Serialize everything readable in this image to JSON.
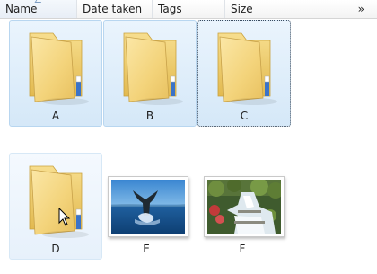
{
  "columns": {
    "name": "Name",
    "date_taken": "Date taken",
    "tags": "Tags",
    "size": "Size",
    "more": "»"
  },
  "items": [
    {
      "label": "A",
      "type": "folder",
      "state": "selected"
    },
    {
      "label": "B",
      "type": "folder",
      "state": "selected"
    },
    {
      "label": "C",
      "type": "folder",
      "state": "selected-focused"
    },
    {
      "label": "D",
      "type": "folder",
      "state": "hover"
    },
    {
      "label": "E",
      "type": "image",
      "icon": "whale-tail-photo-icon"
    },
    {
      "label": "F",
      "type": "image",
      "icon": "waterfall-photo-icon"
    }
  ],
  "colors": {
    "selection": "#d5e8f8",
    "selection_border": "#b8d6f0",
    "folder": "#f5d77a"
  }
}
